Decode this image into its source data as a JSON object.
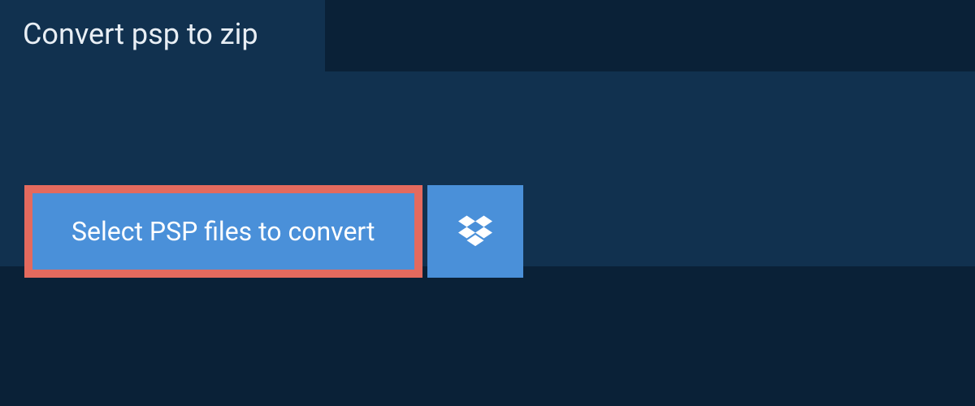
{
  "header": {
    "tab_label": "Convert psp to zip"
  },
  "actions": {
    "select_button_label": "Select PSP files to convert"
  },
  "colors": {
    "page_bg": "#0a2137",
    "panel_bg": "#11314f",
    "button_bg": "#4a90d9",
    "button_border": "#e46a5e",
    "text_light": "#e8eef4",
    "text_white": "#ffffff"
  }
}
